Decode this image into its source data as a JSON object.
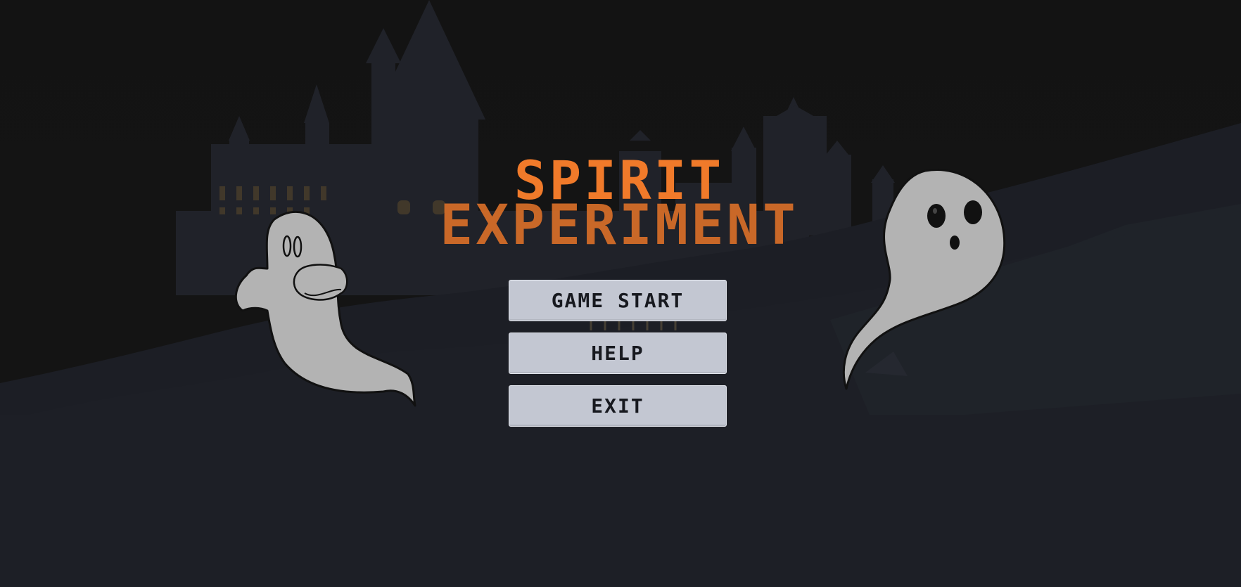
{
  "game": {
    "title_line1": "SPIRIT",
    "title_line2": "EXPERIMENT",
    "title_color": "#f07a2a"
  },
  "menu": {
    "buttons": [
      {
        "label": "GAME START"
      },
      {
        "label": "HELP"
      },
      {
        "label": "EXIT"
      }
    ],
    "button_color": "#c3c7d2",
    "button_text_color": "#17191f"
  },
  "decor": {
    "left_ghost": "ghost-with-oval-eyes",
    "right_ghost": "ghost-with-round-eyes",
    "background": "haunted-castle-night"
  }
}
